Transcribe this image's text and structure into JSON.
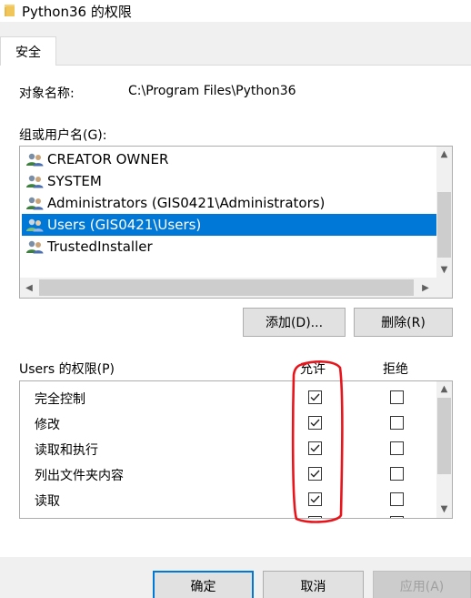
{
  "window": {
    "title": "Python36 的权限",
    "folder_icon": "folder-icon"
  },
  "tabs": [
    {
      "label": "安全",
      "selected": true
    }
  ],
  "object": {
    "label": "对象名称:",
    "value": "C:\\Program Files\\Python36"
  },
  "groups": {
    "label": "组或用户名(G):",
    "items": [
      {
        "label": "CREATOR OWNER",
        "icon": "users-group-icon",
        "selected": false
      },
      {
        "label": "SYSTEM",
        "icon": "users-group-icon",
        "selected": false
      },
      {
        "label": "Administrators (GIS0421\\Administrators)",
        "icon": "users-group-icon",
        "selected": false
      },
      {
        "label": "Users (GIS0421\\Users)",
        "icon": "users-group-icon",
        "selected": true
      },
      {
        "label": "TrustedInstaller",
        "icon": "users-group-icon",
        "selected": false
      }
    ]
  },
  "buttons": {
    "add": "添加(D)...",
    "remove": "删除(R)",
    "ok": "确定",
    "cancel": "取消",
    "apply": "应用(A)"
  },
  "permissions": {
    "title": "Users 的权限(P)",
    "allow_header": "允许",
    "deny_header": "拒绝",
    "rows": [
      {
        "label": "完全控制",
        "allow": true,
        "deny": false
      },
      {
        "label": "修改",
        "allow": true,
        "deny": false
      },
      {
        "label": "读取和执行",
        "allow": true,
        "deny": false
      },
      {
        "label": "列出文件夹内容",
        "allow": true,
        "deny": false
      },
      {
        "label": "读取",
        "allow": true,
        "deny": false
      }
    ]
  },
  "colors": {
    "selection": "#0078d7",
    "annotation": "#e8141c"
  }
}
